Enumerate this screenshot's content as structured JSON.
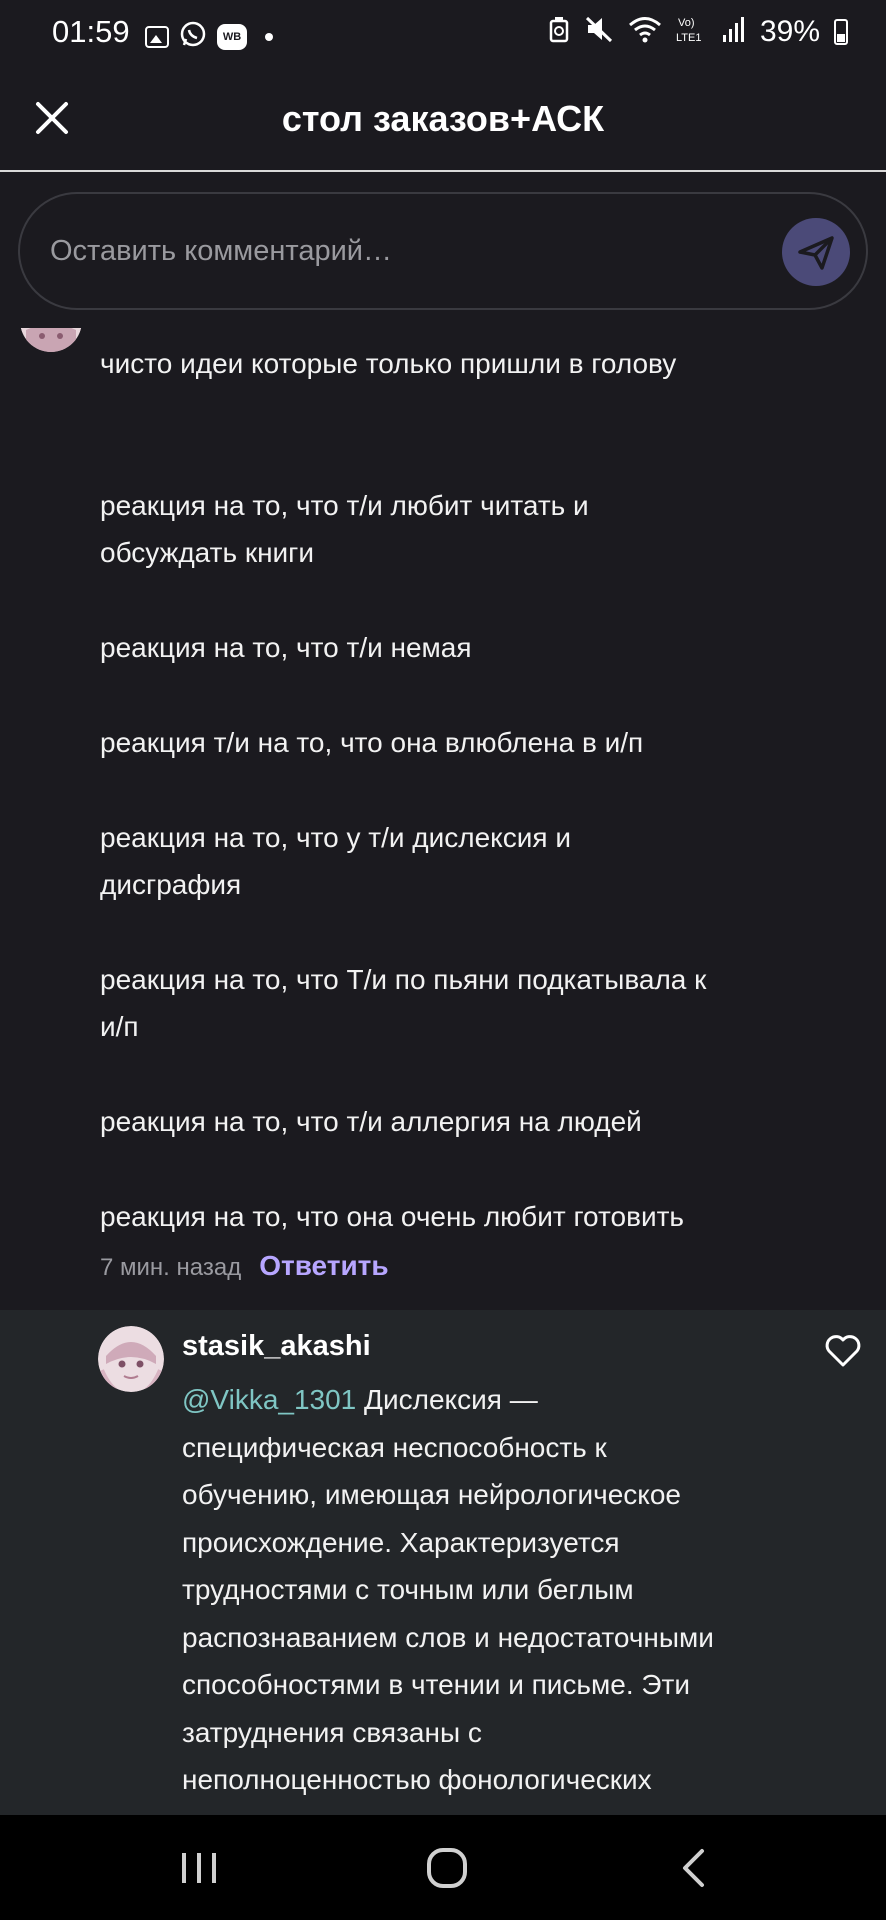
{
  "status_bar": {
    "time": "01:59",
    "wb_label": "WB",
    "battery": "39%",
    "icons": [
      "gallery-icon",
      "whatsapp-icon",
      "wb-icon",
      "dot-icon",
      "recycle-icon",
      "mute-icon",
      "wifi-icon",
      "volte-icon",
      "signal-icon",
      "battery-icon"
    ]
  },
  "header": {
    "title": "стол заказов+АСК"
  },
  "comment_input": {
    "placeholder": "Оставить комментарий…"
  },
  "comment": {
    "lines": [
      "чисто идеи которые  только  пришли в голову",
      "реакция на то, что т/и любит читать и",
      "обсуждать книги",
      "реакция на то, что т/и немая",
      "реакция т/и на то, что она влюблена в и/п",
      "реакция на то, что у т/и дислексия и",
      "дисграфия",
      "реакция на то, что Т/и по пьяни подкатывала к",
      "и/п",
      "реакция на то, что т/и аллергия на людей",
      "реакция на то, что она очень любит готовить"
    ],
    "time_ago": "7 мин. назад",
    "reply_label": "Ответить"
  },
  "reply": {
    "author": "stasik_akashi",
    "mention": "@Vikka_1301",
    "lines": [
      " Дислексия —",
      "специфическая неспособность к",
      "обучению, имеющая нейрологическое",
      "происхождение. Характеризуется",
      "трудностями с точным или беглым",
      "распознаванием слов и недостаточными",
      "способностями в чтении и письме. Эти",
      "затруднения связаны с",
      "неполноценностью фонологических"
    ]
  },
  "colors": {
    "background": "#1b1a1f",
    "reply_background": "#232629",
    "accent": "#b7a6ff",
    "mention": "#7fc6c4",
    "send_button": "#4b4a78"
  }
}
